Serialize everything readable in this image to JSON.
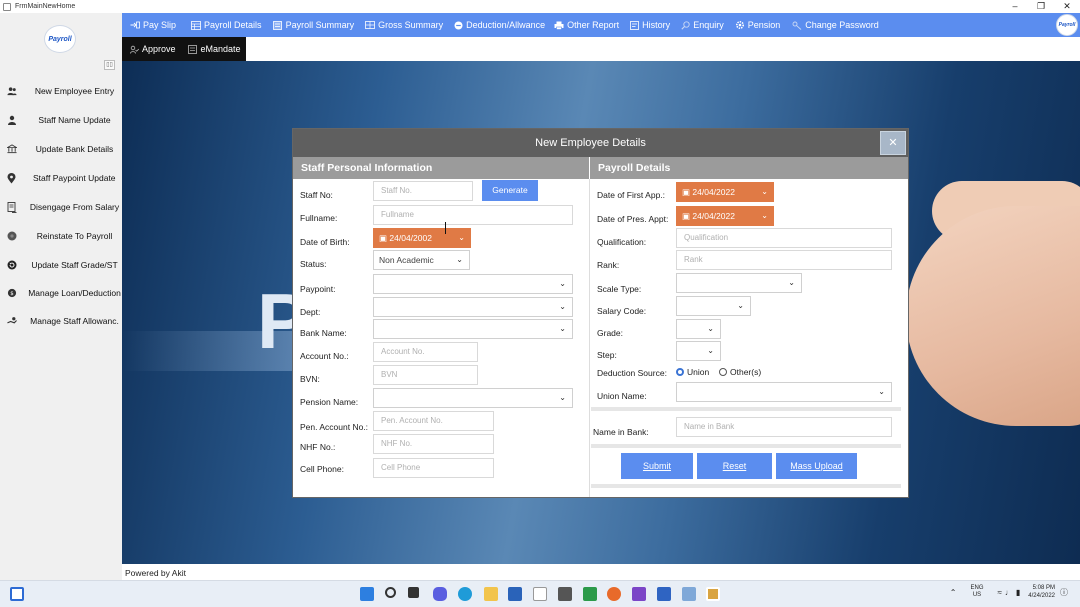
{
  "window": {
    "title": "FrmMainNewHome",
    "min": "–",
    "max": "❐",
    "close": "✕"
  },
  "logo_text": "Payroll",
  "sidebar": {
    "collapse_glyph": "▯▯",
    "items": [
      {
        "label": "New Employee Entry",
        "icon": "users-icon"
      },
      {
        "label": "Staff Name Update",
        "icon": "user-icon"
      },
      {
        "label": "Update Bank Details",
        "icon": "bank-icon"
      },
      {
        "label": "Staff Paypoint Update",
        "icon": "location-icon"
      },
      {
        "label": "Disengage From Salary",
        "icon": "document-icon"
      },
      {
        "label": "Reinstate To Payroll",
        "icon": "circle-icon"
      },
      {
        "label": "Update Staff Grade/ST",
        "icon": "refresh-icon"
      },
      {
        "label": "Manage Loan/Deduction",
        "icon": "money-icon"
      },
      {
        "label": "Manage Staff Allowanc.",
        "icon": "hand-money-icon"
      }
    ]
  },
  "menu": {
    "items": [
      {
        "label": "Pay Slip",
        "icon": "payslip-icon"
      },
      {
        "label": "Payroll Details",
        "icon": "grid-icon"
      },
      {
        "label": "Payroll Summary",
        "icon": "list-icon"
      },
      {
        "label": "Gross Summary",
        "icon": "table-icon"
      },
      {
        "label": "Deduction/Allwance",
        "icon": "minus-circle-icon"
      },
      {
        "label": "Other Report",
        "icon": "printer-icon"
      },
      {
        "label": "History",
        "icon": "history-icon"
      },
      {
        "label": "Enquiry",
        "icon": "search-icon"
      },
      {
        "label": "Pension",
        "icon": "gear-icon"
      },
      {
        "label": "Change Password",
        "icon": "key-icon"
      }
    ],
    "sub": [
      {
        "label": "Approve",
        "icon": "approve-icon"
      },
      {
        "label": "eMandate",
        "icon": "form-icon"
      }
    ]
  },
  "background": {
    "big_letter": "P"
  },
  "footer": {
    "text": "Powered by Akit"
  },
  "dialog": {
    "title": "New Employee Details",
    "close": "✕",
    "left": {
      "heading": "Staff Personal Information",
      "staff_no": {
        "label": "Staff No:",
        "placeholder": "Staff No."
      },
      "generate": "Generate",
      "fullname": {
        "label": "Fullname:",
        "placeholder": "Fullname"
      },
      "dob": {
        "label": "Date of Birth:",
        "value": "24/04/2002"
      },
      "status": {
        "label": "Status:",
        "value": "Non Academic"
      },
      "paypoint": {
        "label": "Paypoint:"
      },
      "dept": {
        "label": "Dept:"
      },
      "bank_name": {
        "label": "Bank Name:"
      },
      "account_no": {
        "label": "Account No.:",
        "placeholder": "Account No."
      },
      "bvn": {
        "label": "BVN:",
        "placeholder": "BVN"
      },
      "pension_name": {
        "label": "Pension Name:"
      },
      "pen_account": {
        "label": "Pen. Account No.:",
        "placeholder": "Pen. Account No."
      },
      "nhf": {
        "label": "NHF No.:",
        "placeholder": "NHF No."
      },
      "cell_phone": {
        "label": "Cell Phone:",
        "placeholder": "Cell Phone"
      }
    },
    "right": {
      "heading": "Payroll Details",
      "first_app": {
        "label": "Date of First App.:",
        "value": "24/04/2022"
      },
      "pres_appt": {
        "label": "Date of Pres. Appt:",
        "value": "24/04/2022"
      },
      "qualification": {
        "label": "Qualification:",
        "placeholder": "Qualification"
      },
      "rank": {
        "label": "Rank:",
        "placeholder": "Rank"
      },
      "scale_type": {
        "label": "Scale Type:"
      },
      "salary_code": {
        "label": "Salary Code:"
      },
      "grade": {
        "label": "Grade:"
      },
      "step": {
        "label": "Step:"
      },
      "deduction_source": {
        "label": "Deduction Source:",
        "options": [
          "Union",
          "Other(s)"
        ],
        "selected": "Union"
      },
      "union_name": {
        "label": "Union Name:"
      },
      "name_in_bank": {
        "label": "Name in Bank:",
        "placeholder": "Name in Bank"
      },
      "submit": "Submit",
      "reset": "Reset",
      "mass_upload": "Mass Upload"
    }
  },
  "taskbar": {
    "lang_line1": "ENG",
    "lang_line2": "US",
    "time": "5:08 PM",
    "date": "4/24/2022"
  },
  "colors": {
    "accent": "#5b8def",
    "date_field": "#e07a45",
    "dialog_header": "#5f5f5f",
    "section_header": "#9b9b9b"
  }
}
